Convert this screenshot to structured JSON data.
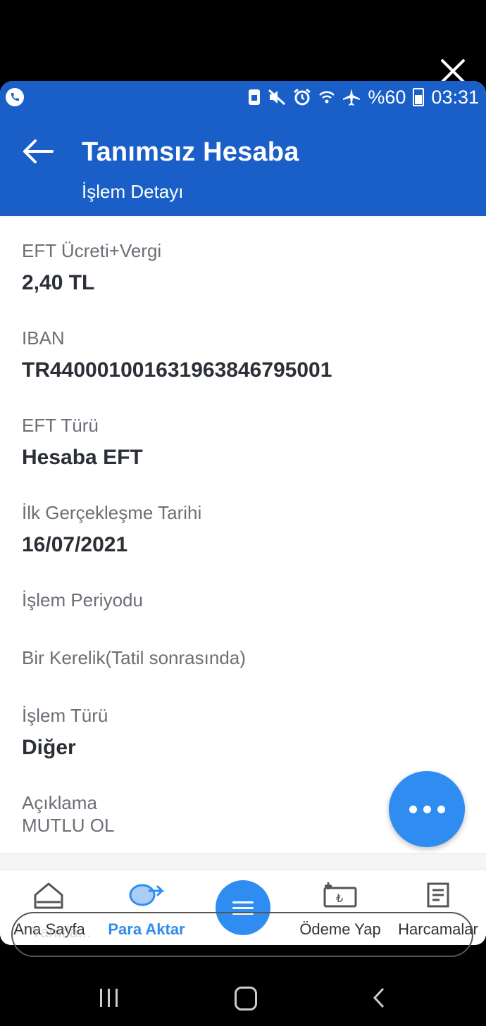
{
  "status_bar": {
    "battery_text": "%60",
    "time": "03:31",
    "icons": [
      "whatsapp-call-icon",
      "sim-lock-icon",
      "mute-icon",
      "alarm-icon",
      "wifi-icon",
      "airplane-icon",
      "battery-icon"
    ]
  },
  "header": {
    "title": "Tanımsız Hesaba",
    "subtitle": "İşlem Detayı"
  },
  "details": [
    {
      "label": "EFT Ücreti+Vergi",
      "value": "2,40 TL"
    },
    {
      "label": "IBAN",
      "value": "TR440001001631963846795001"
    },
    {
      "label": "EFT Türü",
      "value": "Hesaba EFT"
    },
    {
      "label": "İlk Gerçekleşme Tarihi",
      "value": "16/07/2021"
    },
    {
      "label": "İşlem Periyodu",
      "value": "Bir Kerelik(Tatil sonrasında)"
    },
    {
      "label": "İşlem Türü",
      "value": "Diğer"
    },
    {
      "label": "Açıklama",
      "value": "MUTLU OL"
    }
  ],
  "bottom_nav": {
    "items": [
      {
        "label": "Ana Sayfa",
        "icon": "home-icon"
      },
      {
        "label": "Para Aktar",
        "icon": "money-transfer-icon",
        "active": true
      },
      {
        "label": "",
        "icon": "menu-icon"
      },
      {
        "label": "Ödeme Yap",
        "icon": "payment-icon"
      },
      {
        "label": "Harcamalar",
        "icon": "receipt-icon"
      }
    ]
  },
  "ghost_search": {
    "text": "Yanıtla..."
  },
  "colors": {
    "header_blue": "#1a5fc8",
    "accent_blue": "#2f8df1",
    "label_gray": "#6b6f76",
    "value_dark": "#2b2f36"
  }
}
